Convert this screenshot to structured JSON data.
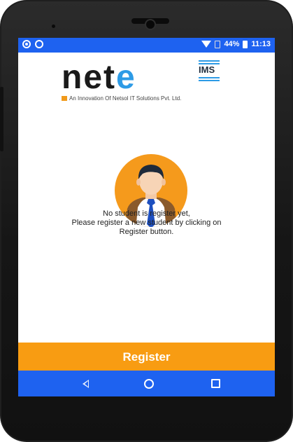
{
  "status_bar": {
    "battery_percent": "44%",
    "time": "11:13",
    "left_icons": [
      "whatsapp-icon",
      "sync-icon"
    ],
    "right_icons": [
      "wifi-icon",
      "sim-icon",
      "battery-icon"
    ]
  },
  "logo": {
    "word_part1": "NET",
    "word_part2": "e",
    "suffix": "IMS",
    "tagline": "An Innovation Of Netsol IT Solutions Pvt. Ltd."
  },
  "empty_state": {
    "line1": "No student is register yet,",
    "line2": "Please register a new student by clicking on",
    "line3": "Register button."
  },
  "register_button": {
    "label": "Register",
    "color": "#f89c12"
  },
  "nav_bar": {
    "color": "#1e62f0",
    "icons": [
      "back-icon",
      "home-icon",
      "recent-apps-icon"
    ]
  }
}
